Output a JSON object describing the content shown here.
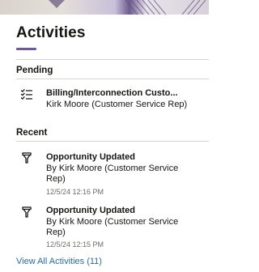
{
  "panel": {
    "title": "Activities"
  },
  "pending": {
    "label": "Pending",
    "items": [
      {
        "icon": "task-list-icon",
        "title": "Billing/Interconnection Custo...",
        "subtitle": "Kirk Moore (Customer Service Rep)"
      }
    ]
  },
  "recent": {
    "label": "Recent",
    "items": [
      {
        "icon": "funnel-icon",
        "title": "Opportunity Updated",
        "subtitle": "By Kirk Moore (Customer Service Rep)",
        "time": "12/5/24 12:16 PM"
      },
      {
        "icon": "funnel-icon",
        "title": "Opportunity Updated",
        "subtitle": "By Kirk Moore (Customer Service Rep)",
        "time": "12/5/24 12:15 PM"
      }
    ]
  },
  "footer": {
    "view_all_label": "View All Activities (11)"
  },
  "colors": {
    "accent_underline": "#6f5a91",
    "link": "#2c6aa6"
  }
}
